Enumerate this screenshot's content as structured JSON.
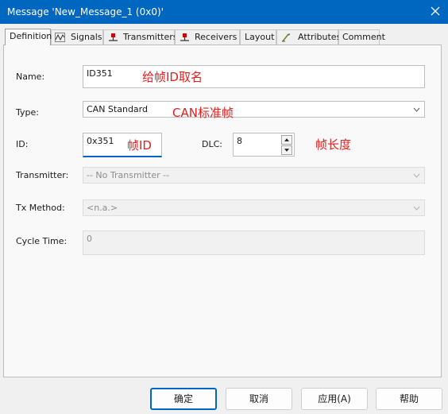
{
  "window": {
    "title": "Message 'New_Message_1 (0x0)'"
  },
  "tabs": [
    {
      "label": "Definition",
      "icon": null
    },
    {
      "label": "Signals",
      "icon": "signals-icon"
    },
    {
      "label": "Transmitters",
      "icon": "transmitter-node-icon"
    },
    {
      "label": "Receivers",
      "icon": "receiver-node-icon"
    },
    {
      "label": "Layout",
      "icon": null
    },
    {
      "label": "Attributes",
      "icon": "attributes-icon"
    },
    {
      "label": "Comment",
      "icon": null
    }
  ],
  "form": {
    "name": {
      "label": "Name:",
      "value": "ID351"
    },
    "type": {
      "label": "Type:",
      "value": "CAN Standard"
    },
    "id": {
      "label": "ID:",
      "value": "0x351"
    },
    "dlc": {
      "label": "DLC:",
      "value": "8"
    },
    "transmitter": {
      "label": "Transmitter:",
      "value": "-- No Transmitter --"
    },
    "tx_method": {
      "label": "Tx Method:",
      "value": "<n.a.>"
    },
    "cycle_time": {
      "label": "Cycle Time:",
      "value": "0"
    }
  },
  "annotations": {
    "name_note": "给帧ID取名",
    "type_note": "CAN标准帧",
    "id_note": "帧ID",
    "dlc_note": "帧长度"
  },
  "buttons": {
    "ok": "确定",
    "cancel": "取消",
    "apply": "应用(A)",
    "help": "帮助"
  },
  "colors": {
    "titlebar": "#0067c0",
    "annotation": "#e0201e",
    "focus_underline": "#0067c0"
  }
}
